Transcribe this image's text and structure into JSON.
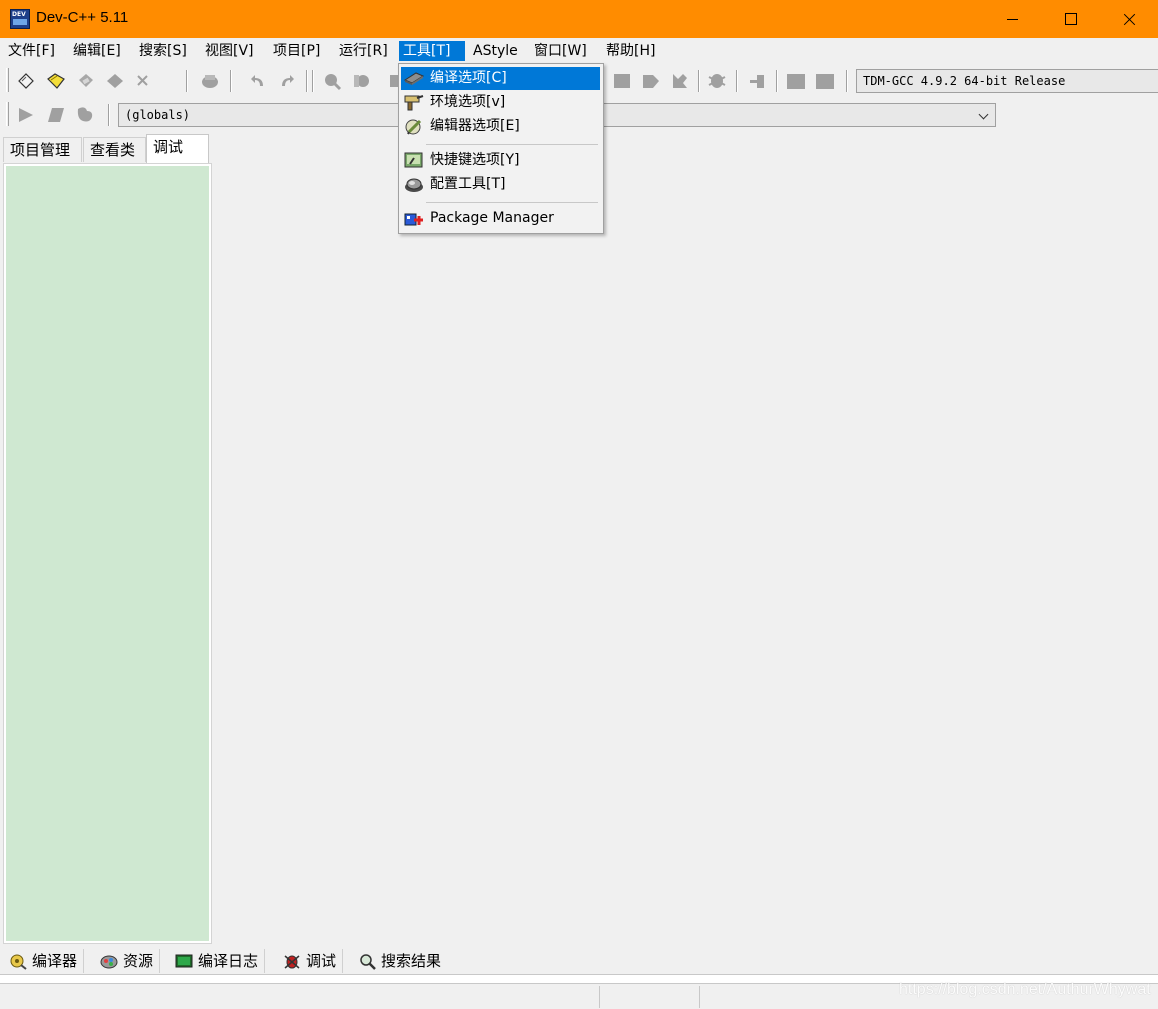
{
  "window": {
    "title": "Dev-C++ 5.11",
    "title_bar_color": "#ff8c00"
  },
  "menubar": [
    {
      "label": "文件[F]"
    },
    {
      "label": "编辑[E]"
    },
    {
      "label": "搜索[S]"
    },
    {
      "label": "视图[V]"
    },
    {
      "label": "项目[P]"
    },
    {
      "label": "运行[R]"
    },
    {
      "label": "工具[T]",
      "active": true
    },
    {
      "label": "AStyle"
    },
    {
      "label": "窗口[W]"
    },
    {
      "label": "帮助[H]"
    }
  ],
  "tools_menu": {
    "items": [
      {
        "label": "编译选项[C]",
        "icon": "compiler-options-icon",
        "highlighted": true
      },
      {
        "label": "环境选项[v]",
        "icon": "environment-options-icon"
      },
      {
        "label": "编辑器选项[E]",
        "icon": "editor-options-icon"
      },
      {
        "label": "快捷键选项[Y]",
        "icon": "shortcut-options-icon"
      },
      {
        "label": "配置工具[T]",
        "icon": "configure-tools-icon"
      },
      {
        "label": "Package Manager",
        "icon": "package-manager-icon"
      }
    ]
  },
  "toolbar": {
    "compiler_select": "TDM-GCC 4.9.2 64-bit Release",
    "scope_select": "(globals)"
  },
  "left_panel": {
    "tabs": [
      "项目管理",
      "查看类",
      "调试"
    ],
    "active_tab": "调试",
    "panel_color": "#cfe8d1"
  },
  "bottom_tabs": [
    {
      "label": "编译器",
      "icon": "compiler-icon"
    },
    {
      "label": "资源",
      "icon": "resources-icon"
    },
    {
      "label": "编译日志",
      "icon": "compile-log-icon"
    },
    {
      "label": "调试",
      "icon": "debug-icon"
    },
    {
      "label": "搜索结果",
      "icon": "search-results-icon"
    }
  ],
  "watermark": "https://blog.csdn.net/AuthurWhywat",
  "accent_color": "#0078d7"
}
